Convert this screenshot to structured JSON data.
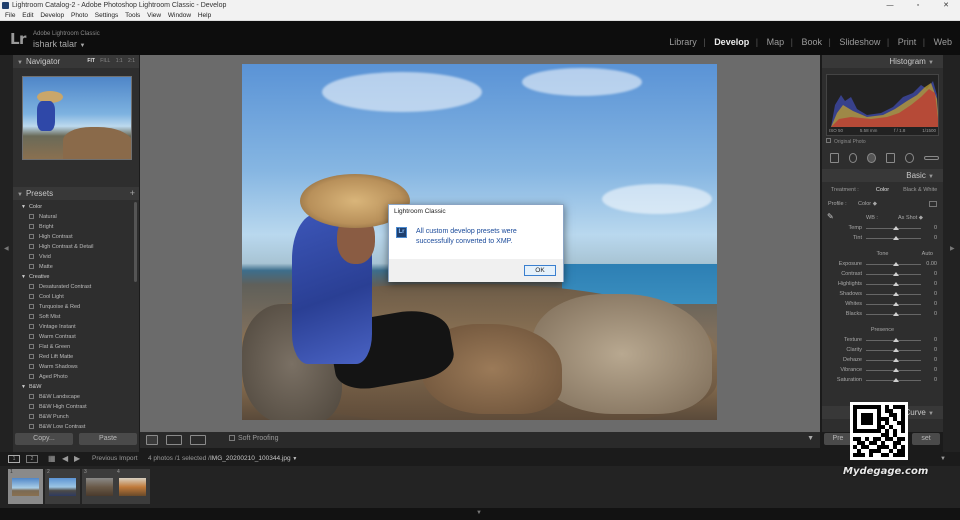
{
  "window": {
    "title": "Lightroom Catalog-2 - Adobe Photoshop Lightroom Classic - Develop",
    "minimize": "—",
    "maximize": "▫",
    "close": "✕"
  },
  "menu": [
    "File",
    "Edit",
    "Develop",
    "Photo",
    "Settings",
    "Tools",
    "View",
    "Window",
    "Help"
  ],
  "identity": {
    "logo": "Lr",
    "app_name": "Adobe Lightroom Classic",
    "user": "ishark talar"
  },
  "modules": {
    "items": [
      "Library",
      "Develop",
      "Map",
      "Book",
      "Slideshow",
      "Print",
      "Web"
    ],
    "active": "Develop",
    "separator": "|"
  },
  "left_panel": {
    "navigator": {
      "title": "Navigator",
      "zoom_options": [
        "FIT",
        "FILL",
        "1:1",
        "2:1"
      ]
    },
    "presets": {
      "title": "Presets",
      "add": "+",
      "groups": [
        {
          "name": "Color",
          "items": [
            "Natural",
            "Bright",
            "High Contrast",
            "High Contrast & Detail",
            "Vivid",
            "Matte"
          ]
        },
        {
          "name": "Creative",
          "items": [
            "Desaturated Contrast",
            "Cool Light",
            "Turquoise & Red",
            "Soft Mist",
            "Vintage Instant",
            "Warm Contrast",
            "Flat & Green",
            "Red Lift Matte",
            "Warm Shadows",
            "Aged Photo"
          ]
        },
        {
          "name": "B&W",
          "items": [
            "B&W Landscape",
            "B&W High Contrast",
            "B&W Punch",
            "B&W Low Contrast"
          ]
        }
      ]
    },
    "copy_label": "Copy...",
    "paste_label": "Paste"
  },
  "center": {
    "soft_proofing": "Soft Proofing",
    "toolbar_icons": [
      "loupe-view-icon",
      "before-after-icon",
      "compare-icon"
    ]
  },
  "dialog": {
    "title": "Lightroom Classic",
    "icon_text": "Lr",
    "message": "All custom develop presets were successfully converted to XMP.",
    "ok": "OK"
  },
  "right_panel": {
    "histogram": {
      "title": "Histogram",
      "iso": "ISO 50",
      "focal": "5.58 mm",
      "aperture": "f / 1.8",
      "shutter": "1/1500",
      "original_photo": "Original Photo"
    },
    "basic": {
      "title": "Basic",
      "treatment_label": "Treatment :",
      "treatment_options": [
        "Color",
        "Black & White"
      ],
      "treatment_selected": "Color",
      "profile_label": "Profile :",
      "profile_value": "Color",
      "wb_label": "WB :",
      "wb_value": "As Shot",
      "sliders": [
        {
          "label": "Temp",
          "value": "0"
        },
        {
          "label": "Tint",
          "value": "0"
        }
      ],
      "tone_title": "Tone",
      "tone_auto": "Auto",
      "tone_sliders": [
        {
          "label": "Exposure",
          "value": "0.00"
        },
        {
          "label": "Contrast",
          "value": "0"
        },
        {
          "label": "Highlights",
          "value": "0"
        },
        {
          "label": "Shadows",
          "value": "0"
        },
        {
          "label": "Whites",
          "value": "0"
        },
        {
          "label": "Blacks",
          "value": "0"
        }
      ],
      "presence_title": "Presence",
      "presence_sliders": [
        {
          "label": "Texture",
          "value": "0"
        },
        {
          "label": "Clarity",
          "value": "0"
        },
        {
          "label": "Dehaze",
          "value": "0"
        },
        {
          "label": "Vibrance",
          "value": "0"
        },
        {
          "label": "Saturation",
          "value": "0"
        }
      ]
    },
    "tone_curve_label": "Curve",
    "previous_label": "Pre",
    "reset_label": "set"
  },
  "filmstrip": {
    "view1": "1",
    "view2": "2",
    "source": "Previous Import",
    "status": "4 photos /1 selected /",
    "filename": "IMG_20200210_100344.jpg",
    "thumb_numbers": [
      "1",
      "2",
      "3",
      "4"
    ]
  },
  "watermark": "Mydegage.com",
  "colors": {
    "accent": "#1a4a9a",
    "panel": "#2e2e2e",
    "center_bg": "#6b6b6b"
  }
}
